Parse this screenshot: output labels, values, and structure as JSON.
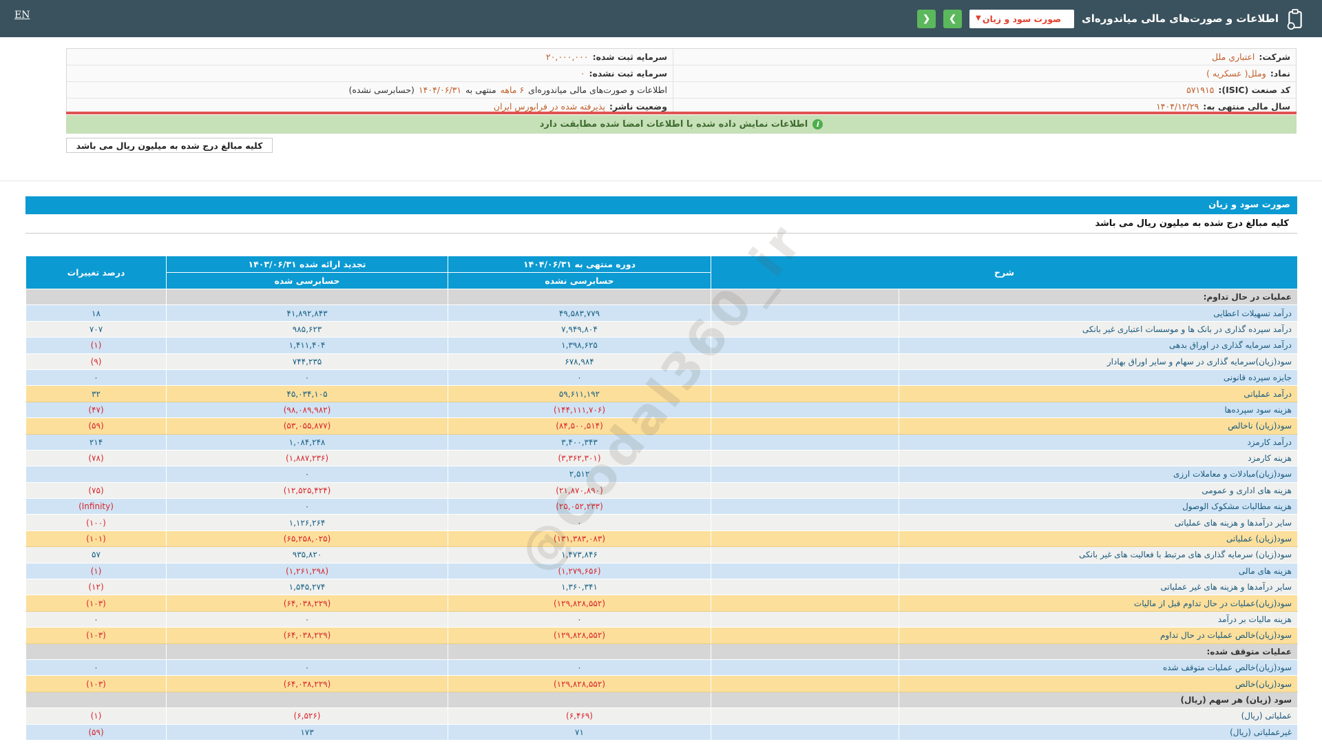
{
  "colors": {
    "topbar_bg": "#3a525d",
    "accent_blue": "#0c9ad2",
    "button_green": "#5cb85c",
    "dropdown_red": "#e2402e",
    "value_orange": "#c05f2b",
    "notice_green_bg": "#c6e0b8",
    "red_divider": "#e05252",
    "row_blue": "#cfe3f4",
    "row_white": "#f0f0ee",
    "row_yellow": "#fcdf9b",
    "section_gray": "#d6d6d6",
    "positive_blue": "#176085",
    "negative_red": "#d9252b"
  },
  "topbar": {
    "en_label": "EN",
    "title": "اطلاعات و صورت‌های مالی میاندوره‌ای",
    "statement_select_value": "صورت سود و زیان",
    "select_chevron": "▼",
    "forward_button": "❯",
    "back_button": "❮"
  },
  "company": {
    "row1": {
      "r_label": "شرکت:",
      "r_value": "اعتباري ملل",
      "l_label": "سرمایه ثبت شده:",
      "l_value": "۲۰,۰۰۰,۰۰۰"
    },
    "row2": {
      "r_label": "نماد:",
      "r_value": "وملل( عسکریه )",
      "l_label": "سرمایه ثبت نشده:",
      "l_value": "۰"
    },
    "row3": {
      "r_label": "کد صنعت (ISIC):",
      "r_value": "۵۷۱۹۱۵",
      "report_line": {
        "p1": "اطلاعات و صورت‌های مالی میاندوره‌ای ",
        "p2": "۶ ماهه",
        "p3": " منتهی به ",
        "p4": "۱۴۰۴/۰۶/۳۱",
        "p5": "(حسابرسی نشده)"
      }
    },
    "row4": {
      "r_label": "سال مالی منتهی به:",
      "r_value": "۱۴۰۴/۱۲/۲۹",
      "l_label": "وضعیت ناشر:",
      "l_value": "پذیرفته شده در فرابورس ایران"
    }
  },
  "notice": {
    "text": "اطلاعات نمایش داده شده با اطلاعات امضا شده مطابقت دارد"
  },
  "units_note": "کلیه مبالغ درج شده به میلیون ریال می باشد",
  "statement": {
    "title": "صورت سود و زیان",
    "units_note": "کلیه مبالغ درج شده به میلیون ریال می باشد"
  },
  "watermark": {
    "text": "@Codal360_ir"
  },
  "table": {
    "headers": {
      "desc": "شرح",
      "current_period": "دوره منتهی به ۱۴۰۴/۰۶/۳۱",
      "current_sub": "حسابرسی نشده",
      "restated": "تجدید ارائه شده ۱۴۰۳/۰۶/۳۱",
      "restated_sub": "حسابرسی شده",
      "change": "درصد تغییرات"
    },
    "rows": [
      {
        "type": "section",
        "label": "عملیات در حال تداوم:"
      },
      {
        "type": "data",
        "tone": "blue",
        "label": "درآمد تسهیلات اعطایی",
        "current": "۴۹,۵۸۳,۷۷۹",
        "restated": "۴۱,۸۹۲,۸۴۳",
        "change": "۱۸"
      },
      {
        "type": "data",
        "tone": "white",
        "label": "درآمد سپرده گذاری در بانک ها و موسسات اعتباری غیر بانکی",
        "current": "۷,۹۴۹,۸۰۴",
        "restated": "۹۸۵,۶۲۳",
        "change": "۷۰۷"
      },
      {
        "type": "data",
        "tone": "blue",
        "label": "درآمد سرمایه گذاری در اوراق بدهی",
        "current": "۱,۳۹۸,۶۲۵",
        "restated": "۱,۴۱۱,۴۰۴",
        "change": "(۱)"
      },
      {
        "type": "data",
        "tone": "white",
        "label": "سود(زیان)سرمایه گذاری در سهام و سایر اوراق بهادار",
        "current": "۶۷۸,۹۸۴",
        "restated": "۷۴۴,۲۳۵",
        "change": "(۹)"
      },
      {
        "type": "data",
        "tone": "blue",
        "label": "جایزه سپرده قانونی",
        "current": "۰",
        "restated": "۰",
        "change": "۰"
      },
      {
        "type": "data",
        "tone": "yellow",
        "label": "درآمد عملیاتی",
        "current": "۵۹,۶۱۱,۱۹۲",
        "restated": "۴۵,۰۳۴,۱۰۵",
        "change": "۳۲"
      },
      {
        "type": "data",
        "tone": "blue",
        "label": "هزینه سود سپرده‌ها",
        "current": "(۱۴۴,۱۱۱,۷۰۶)",
        "restated": "(۹۸,۰۸۹,۹۸۲)",
        "change": "(۴۷)"
      },
      {
        "type": "data",
        "tone": "yellow",
        "label": "سود(زیان) ناخالص",
        "current": "(۸۴,۵۰۰,۵۱۴)",
        "restated": "(۵۳,۰۵۵,۸۷۷)",
        "change": "(۵۹)"
      },
      {
        "type": "data",
        "tone": "blue",
        "label": "درآمد کارمزد",
        "current": "۳,۴۰۰,۳۴۳",
        "restated": "۱,۰۸۴,۲۴۸",
        "change": "۲۱۴"
      },
      {
        "type": "data",
        "tone": "white",
        "label": "هزینه کارمزد",
        "current": "(۳,۳۶۲,۳۰۱)",
        "restated": "(۱,۸۸۷,۲۳۶)",
        "change": "(۷۸)"
      },
      {
        "type": "data",
        "tone": "blue",
        "label": "سود(زیان)مبادلات و معاملات ارزی",
        "current": "۲,۵۱۲",
        "restated": "۰",
        "change": ""
      },
      {
        "type": "data",
        "tone": "white",
        "label": "هزینه های اداری و عمومی",
        "current": "(۲۱,۸۷۰,۸۹۰)",
        "restated": "(۱۲,۵۲۵,۴۲۴)",
        "change": "(۷۵)"
      },
      {
        "type": "data",
        "tone": "blue",
        "label": "هزینه مطالبات مشکوک الوصول",
        "current": "(۲۵,۰۵۲,۲۳۳)",
        "restated": "۰",
        "change": "(Infinity)"
      },
      {
        "type": "data",
        "tone": "white",
        "label": "سایر درآمدها و هزینه های عملیاتی",
        "current": "۰",
        "restated": "۱,۱۲۶,۲۶۴",
        "change": "(۱۰۰)"
      },
      {
        "type": "data",
        "tone": "yellow",
        "label": "سود(زیان) عملیاتی",
        "current": "(۱۳۱,۳۸۳,۰۸۳)",
        "restated": "(۶۵,۲۵۸,۰۲۵)",
        "change": "(۱۰۱)"
      },
      {
        "type": "data",
        "tone": "white",
        "label": "سود(زیان) سرمایه گذاری های مرتبط با فعالیت های غیر بانکی",
        "current": "۱,۴۷۳,۸۴۶",
        "restated": "۹۳۵,۸۲۰",
        "change": "۵۷"
      },
      {
        "type": "data",
        "tone": "blue",
        "label": "هزینه های مالی",
        "current": "(۱,۲۷۹,۶۵۶)",
        "restated": "(۱,۲۶۱,۲۹۸)",
        "change": "(۱)"
      },
      {
        "type": "data",
        "tone": "white",
        "label": "سایر درآمدها و هزینه های غیر عملیاتی",
        "current": "۱,۳۶۰,۳۴۱",
        "restated": "۱,۵۴۵,۲۷۴",
        "change": "(۱۲)"
      },
      {
        "type": "data",
        "tone": "yellow",
        "label": "سود(زیان)عملیات در حال تداوم قبل از مالیات",
        "current": "(۱۲۹,۸۲۸,۵۵۲)",
        "restated": "(۶۴,۰۳۸,۲۲۹)",
        "change": "(۱۰۳)"
      },
      {
        "type": "data",
        "tone": "white",
        "label": "هزینه مالیات بر درآمد",
        "current": "۰",
        "restated": "۰",
        "change": "۰"
      },
      {
        "type": "data",
        "tone": "yellow",
        "label": "سود(زیان)خالص عملیات در حال تداوم",
        "current": "(۱۲۹,۸۲۸,۵۵۲)",
        "restated": "(۶۴,۰۳۸,۲۲۹)",
        "change": "(۱۰۳)"
      },
      {
        "type": "section",
        "label": "عملیات متوقف شده:"
      },
      {
        "type": "data",
        "tone": "blue",
        "label": "سود(زیان)خالص عملیات متوقف شده",
        "current": "۰",
        "restated": "۰",
        "change": "۰"
      },
      {
        "type": "data",
        "tone": "yellow",
        "label": "سود(زیان)خالص",
        "current": "(۱۲۹,۸۲۸,۵۵۲)",
        "restated": "(۶۴,۰۳۸,۲۲۹)",
        "change": "(۱۰۳)"
      },
      {
        "type": "section",
        "label": "سود (زیان) هر سهم (ریال)"
      },
      {
        "type": "data",
        "tone": "white",
        "label": "عملیاتی (ریال)",
        "current": "(۶,۴۶۹)",
        "restated": "(۶,۵۲۶)",
        "change": "(۱)"
      },
      {
        "type": "data",
        "tone": "blue",
        "label": "غیرعملیاتی (ریال)",
        "current": "۷۱",
        "restated": "۱۷۳",
        "change": "(۵۹)"
      }
    ]
  }
}
